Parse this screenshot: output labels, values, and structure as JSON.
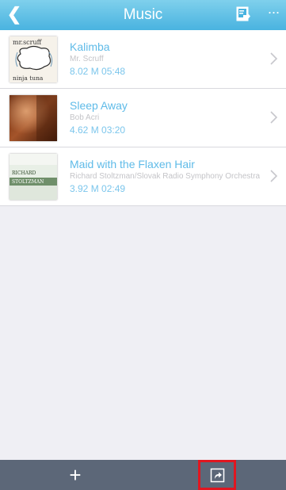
{
  "navbar": {
    "back_label": "❮",
    "title": "Music",
    "doc_icon": "document-icon",
    "more_label": "···"
  },
  "tracks": [
    {
      "title": "Kalimba",
      "artist": "Mr. Scruff",
      "meta": "8.02 M 05:48",
      "cover_top_text": "mr.scruff",
      "cover_bottom_text": "ninja tuna"
    },
    {
      "title": "Sleep Away",
      "artist": "Bob Acri",
      "meta": "4.62 M 03:20"
    },
    {
      "title": "Maid with the Flaxen Hair",
      "artist": "Richard Stoltzman/Slovak Radio Symphony Orchestra",
      "meta": "3.92 M 02:49",
      "cover_text_1": "RICHARD",
      "cover_text_2": "STOLTZMAN"
    }
  ],
  "toolbar": {
    "add_label": "+",
    "share_icon": "share-icon"
  },
  "colors": {
    "navbar_top": "#7fd0ec",
    "navbar_bottom": "#49b3e0",
    "title_blue": "#5fbbe8",
    "toolbar_bg": "#5c6778",
    "highlight_red": "#e01620"
  }
}
